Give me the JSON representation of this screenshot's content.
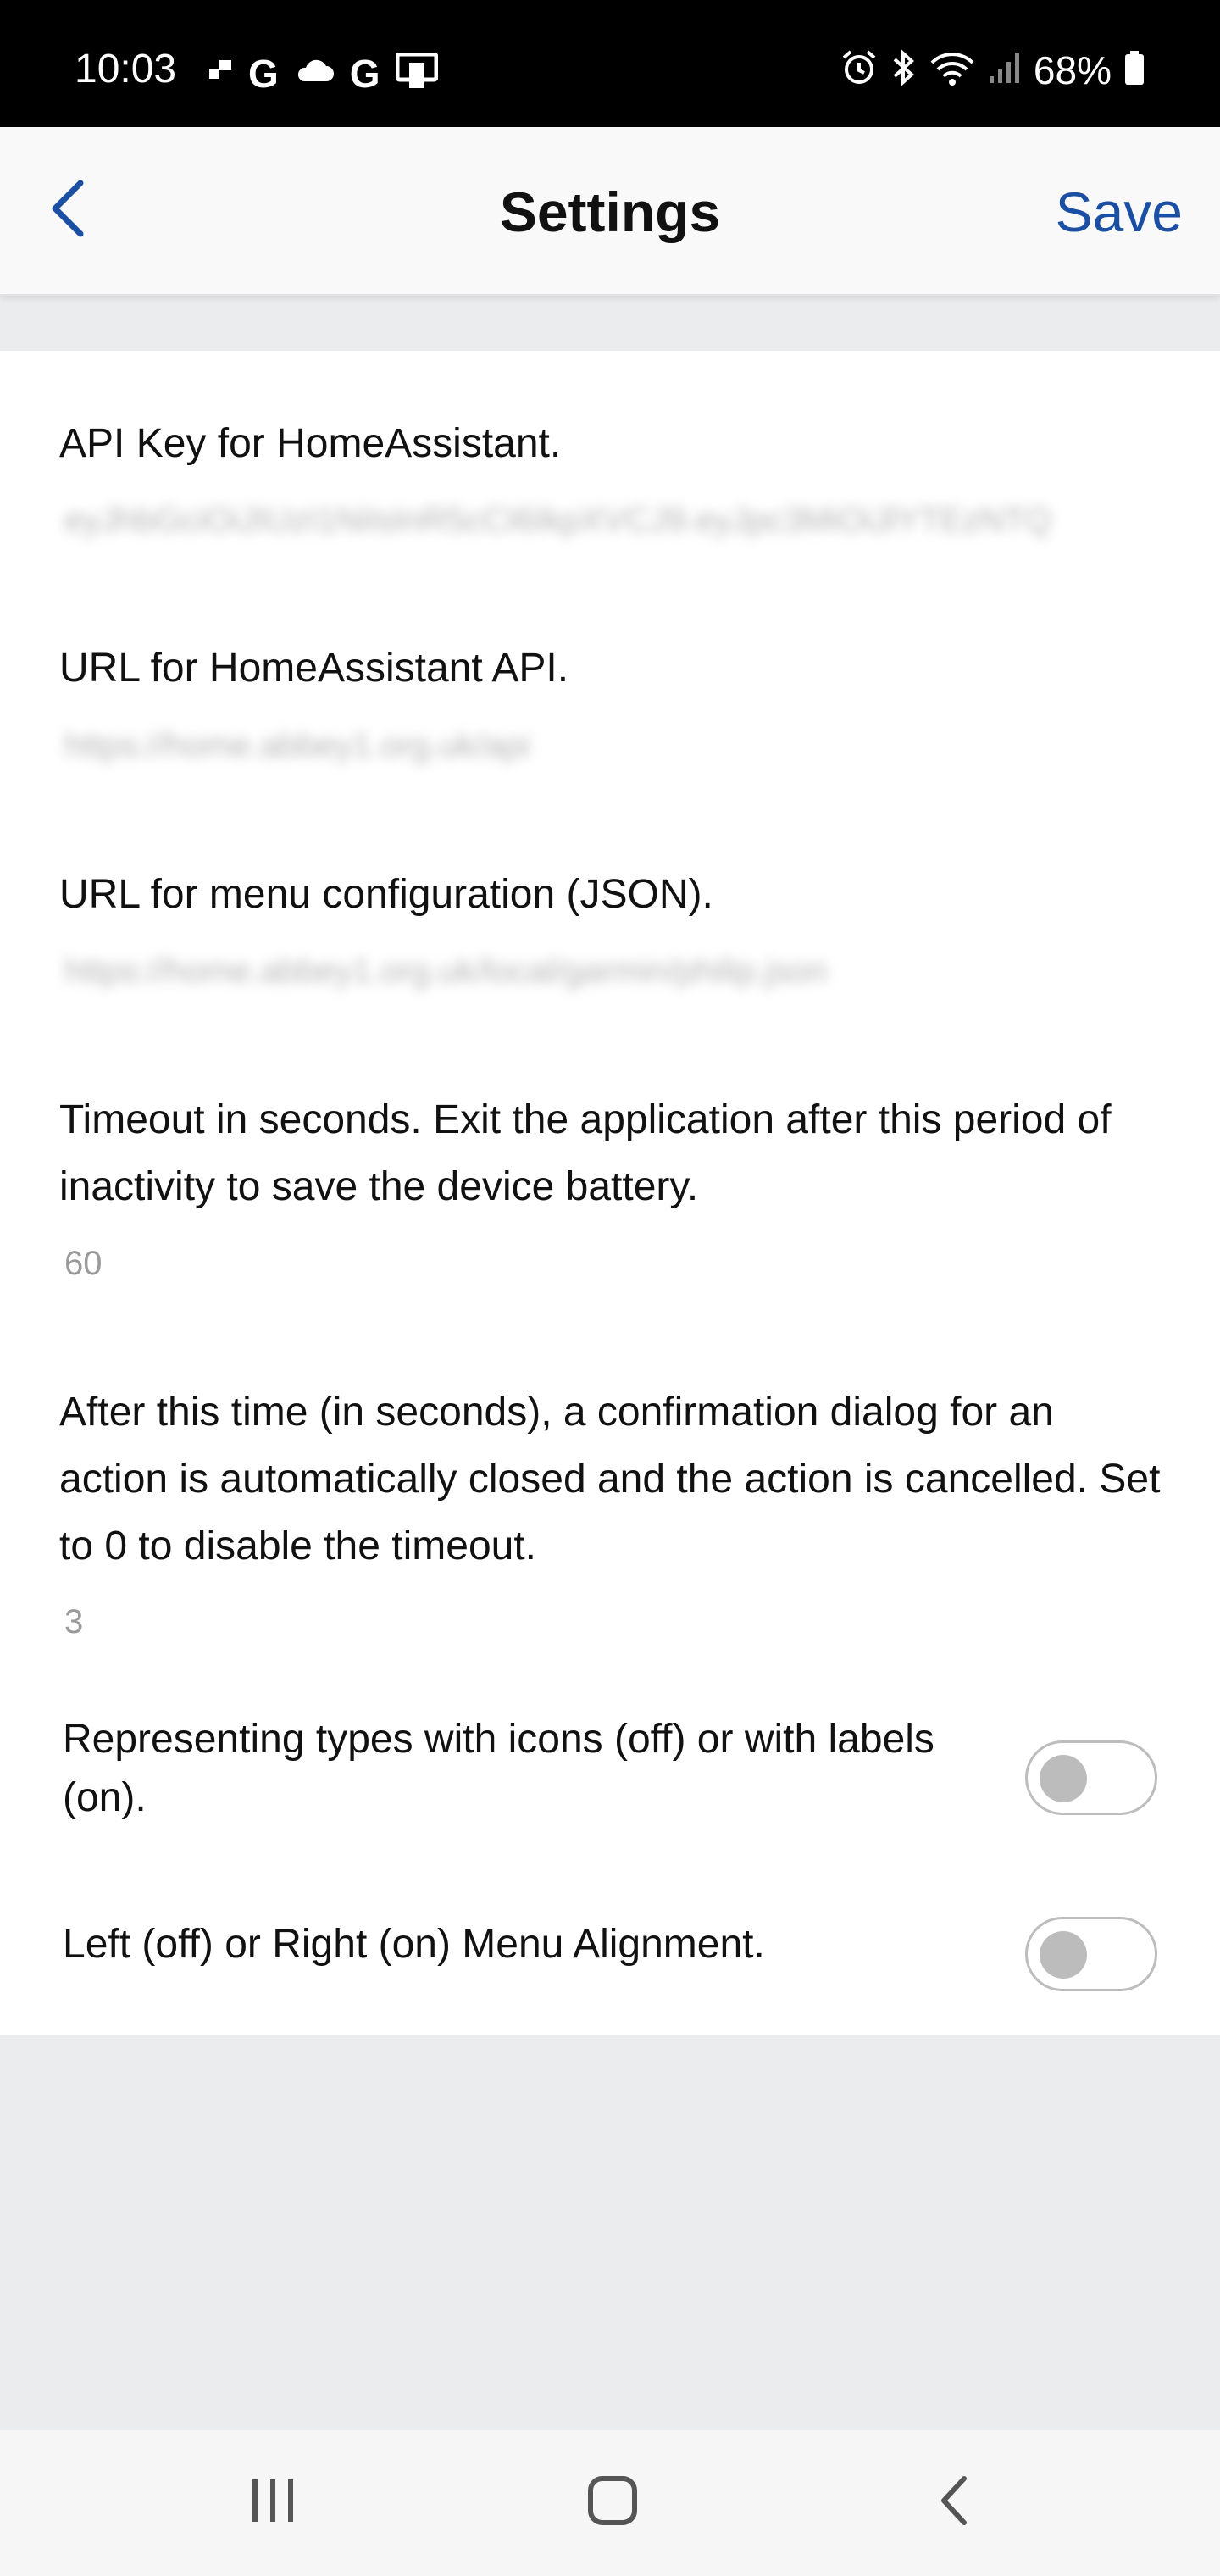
{
  "status_bar": {
    "time": "10:03",
    "g_letters": [
      "G",
      "G"
    ],
    "battery_percent": "68%",
    "icons_left": [
      "flow-icon",
      "google-icon",
      "cloud-icon",
      "google-icon",
      "screen-mirror-icon"
    ],
    "icons_right": [
      "alarm-icon",
      "bluetooth-icon",
      "wifi-icon",
      "cellular-signal-icon",
      "battery-icon"
    ]
  },
  "header": {
    "title": "Settings",
    "save_label": "Save",
    "back_icon": "chevron-left-icon"
  },
  "settings": {
    "api_key": {
      "label": "API Key for HomeAssistant.",
      "value": "eyJhbGciOiJIUzI1NiIsInR5cCI6IkpXVCJ9.eyJpc3MiOiJlYTEzNTQ"
    },
    "api_url": {
      "label": "URL for HomeAssistant API.",
      "value": "https://home.abbey1.org.uk/api"
    },
    "menu_url": {
      "label": "URL for menu configuration (JSON).",
      "value": "https://home.abbey1.org.uk/local/garmin/philip.json"
    },
    "timeout": {
      "label": "Timeout in seconds. Exit the application after this period of inactivity to save the device battery.",
      "value": "60"
    },
    "confirm_timeout": {
      "label": "After this time (in seconds), a confirmation dialog for an action is automatically closed and the action is cancelled. Set to 0 to disable the timeout.",
      "value": "3"
    },
    "types_toggle": {
      "label": "Representing types with icons (off) or with labels (on).",
      "on": false
    },
    "alignment_toggle": {
      "label": "Left (off) or Right (on) Menu Alignment.",
      "on": false
    }
  },
  "nav_bar": {
    "icons": [
      "recent-apps-icon",
      "home-icon",
      "back-icon"
    ]
  },
  "colors": {
    "accent": "#1a4fa3",
    "status_bar_bg": "#000000",
    "page_bg": "#ebecee",
    "card_bg": "#ffffff",
    "value_text": "#9a9a9a"
  }
}
